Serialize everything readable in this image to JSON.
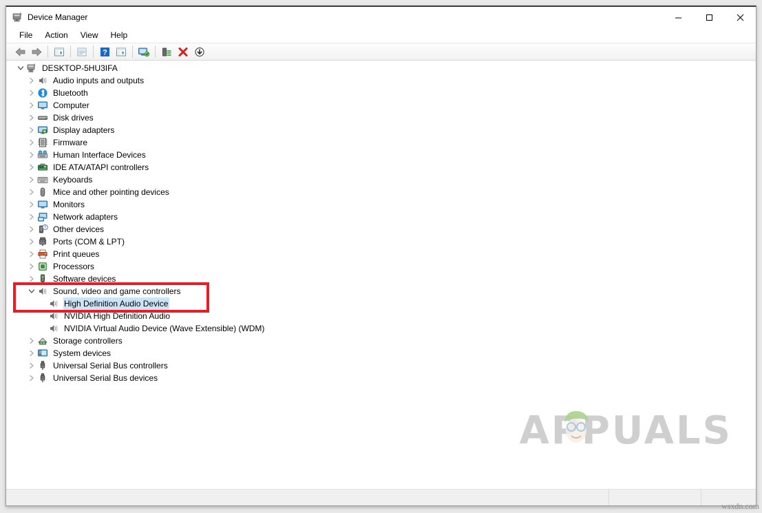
{
  "window": {
    "title": "Device Manager",
    "icon": "device-manager-icon",
    "controls": {
      "minimize": "Minimize",
      "maximize": "Maximize",
      "close": "Close"
    }
  },
  "menubar": {
    "items": [
      {
        "label": "File"
      },
      {
        "label": "Action"
      },
      {
        "label": "View"
      },
      {
        "label": "Help"
      }
    ]
  },
  "toolbar": {
    "buttons": [
      {
        "name": "back-icon",
        "tooltip": "Back"
      },
      {
        "name": "forward-icon",
        "tooltip": "Forward"
      },
      {
        "name": "separator-1"
      },
      {
        "name": "show-hide-console-tree-icon",
        "tooltip": "Show/Hide Console Tree"
      },
      {
        "name": "separator-2"
      },
      {
        "name": "properties-icon",
        "tooltip": "Properties"
      },
      {
        "name": "separator-3"
      },
      {
        "name": "help-icon",
        "tooltip": "Help"
      },
      {
        "name": "show-hide-action-pane-icon",
        "tooltip": "Show/Hide Action Pane"
      },
      {
        "name": "separator-4"
      },
      {
        "name": "scan-for-hardware-changes-icon",
        "tooltip": "Scan for hardware changes"
      },
      {
        "name": "separator-5"
      },
      {
        "name": "update-driver-icon",
        "tooltip": "Update driver"
      },
      {
        "name": "uninstall-device-icon",
        "tooltip": "Uninstall device"
      },
      {
        "name": "disable-device-icon",
        "tooltip": "Disable device"
      }
    ]
  },
  "tree": {
    "root": {
      "label": "DESKTOP-5HU3IFA",
      "icon": "computer-node-icon",
      "expanded": true
    },
    "items": [
      {
        "label": "Audio inputs and outputs",
        "icon": "speaker-icon",
        "level": 1,
        "expandable": true,
        "expanded": false
      },
      {
        "label": "Bluetooth",
        "icon": "bluetooth-icon",
        "level": 1,
        "expandable": true,
        "expanded": false
      },
      {
        "label": "Computer",
        "icon": "monitor-icon",
        "level": 1,
        "expandable": true,
        "expanded": false
      },
      {
        "label": "Disk drives",
        "icon": "disk-drive-icon",
        "level": 1,
        "expandable": true,
        "expanded": false
      },
      {
        "label": "Display adapters",
        "icon": "display-adapter-icon",
        "level": 1,
        "expandable": true,
        "expanded": false
      },
      {
        "label": "Firmware",
        "icon": "firmware-chip-icon",
        "level": 1,
        "expandable": true,
        "expanded": false
      },
      {
        "label": "Human Interface Devices",
        "icon": "hid-icon",
        "level": 1,
        "expandable": true,
        "expanded": false
      },
      {
        "label": "IDE ATA/ATAPI controllers",
        "icon": "ide-controller-icon",
        "level": 1,
        "expandable": true,
        "expanded": false
      },
      {
        "label": "Keyboards",
        "icon": "keyboard-icon",
        "level": 1,
        "expandable": true,
        "expanded": false
      },
      {
        "label": "Mice and other pointing devices",
        "icon": "mouse-icon",
        "level": 1,
        "expandable": true,
        "expanded": false
      },
      {
        "label": "Monitors",
        "icon": "monitor-icon",
        "level": 1,
        "expandable": true,
        "expanded": false
      },
      {
        "label": "Network adapters",
        "icon": "network-adapter-icon",
        "level": 1,
        "expandable": true,
        "expanded": false
      },
      {
        "label": "Other devices",
        "icon": "other-device-icon",
        "level": 1,
        "expandable": true,
        "expanded": false
      },
      {
        "label": "Ports (COM & LPT)",
        "icon": "port-icon",
        "level": 1,
        "expandable": true,
        "expanded": false
      },
      {
        "label": "Print queues",
        "icon": "printer-icon",
        "level": 1,
        "expandable": true,
        "expanded": false
      },
      {
        "label": "Processors",
        "icon": "processor-icon",
        "level": 1,
        "expandable": true,
        "expanded": false
      },
      {
        "label": "Software devices",
        "icon": "software-device-icon",
        "level": 1,
        "expandable": true,
        "expanded": false
      },
      {
        "label": "Sound, video and game controllers",
        "icon": "speaker-icon",
        "level": 1,
        "expandable": true,
        "expanded": true
      },
      {
        "label": "High Definition Audio Device",
        "icon": "speaker-icon",
        "level": 2,
        "expandable": false,
        "selected": true
      },
      {
        "label": "NVIDIA High Definition Audio",
        "icon": "speaker-icon",
        "level": 2,
        "expandable": false
      },
      {
        "label": "NVIDIA Virtual Audio Device (Wave Extensible) (WDM)",
        "icon": "speaker-icon",
        "level": 2,
        "expandable": false
      },
      {
        "label": "Storage controllers",
        "icon": "storage-controller-icon",
        "level": 1,
        "expandable": true,
        "expanded": false
      },
      {
        "label": "System devices",
        "icon": "system-device-icon",
        "level": 1,
        "expandable": true,
        "expanded": false
      },
      {
        "label": "Universal Serial Bus controllers",
        "icon": "usb-icon",
        "level": 1,
        "expandable": true,
        "expanded": false
      },
      {
        "label": "Universal Serial Bus devices",
        "icon": "usb-icon",
        "level": 1,
        "expandable": true,
        "expanded": false
      }
    ]
  },
  "annotation": {
    "color": "#ec1c24",
    "label": "highlight-sound-controllers"
  },
  "statusbar": {
    "main": "",
    "panel_a": "",
    "panel_b": ""
  },
  "watermark": {
    "brand": "APPUALS",
    "source": "wsxdn.com",
    "color": "#cfcfcf"
  }
}
